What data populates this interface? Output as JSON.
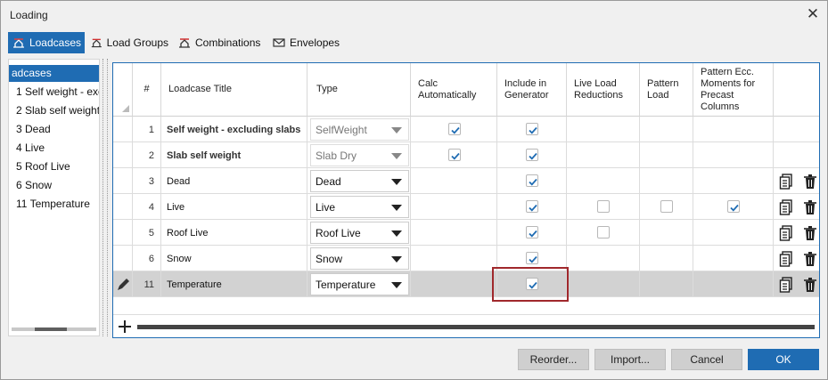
{
  "window": {
    "title": "Loading"
  },
  "tabs": [
    {
      "label": "Loadcases",
      "icon": "loadcase-icon"
    },
    {
      "label": "Load Groups",
      "icon": "load-group-icon"
    },
    {
      "label": "Combinations",
      "icon": "combination-icon"
    },
    {
      "label": "Envelopes",
      "icon": "envelope-icon"
    }
  ],
  "sidebar": {
    "items": [
      {
        "label": "adcases"
      },
      {
        "label": "1 Self weight - exc"
      },
      {
        "label": "2 Slab self weight"
      },
      {
        "label": "3 Dead"
      },
      {
        "label": "4 Live"
      },
      {
        "label": "5 Roof Live"
      },
      {
        "label": "6 Snow"
      },
      {
        "label": "11 Temperature"
      }
    ]
  },
  "grid": {
    "headers": {
      "num": "#",
      "title": "Loadcase Title",
      "type": "Type",
      "calc": "Calc Automatically",
      "include": "Include in Generator",
      "live": "Live Load Reductions",
      "pattern": "Pattern Load",
      "patecc": "Pattern Ecc. Moments for Precast Columns"
    },
    "rows": [
      {
        "num": "1",
        "title": "Self weight - excluding slabs",
        "bold": true,
        "type": "SelfWeight",
        "type_disabled": true,
        "calc": true,
        "include": true,
        "live": null,
        "pattern": null,
        "patecc": null,
        "actions": false
      },
      {
        "num": "2",
        "title": "Slab self weight",
        "bold": true,
        "type": "Slab Dry",
        "type_disabled": true,
        "calc": true,
        "include": true,
        "live": null,
        "pattern": null,
        "patecc": null,
        "actions": false
      },
      {
        "num": "3",
        "title": "Dead",
        "bold": false,
        "type": "Dead",
        "type_disabled": false,
        "calc": null,
        "include": true,
        "live": null,
        "pattern": null,
        "patecc": null,
        "actions": true
      },
      {
        "num": "4",
        "title": "Live",
        "bold": false,
        "type": "Live",
        "type_disabled": false,
        "calc": null,
        "include": true,
        "live": false,
        "pattern": false,
        "patecc": true,
        "actions": true
      },
      {
        "num": "5",
        "title": "Roof Live",
        "bold": false,
        "type": "Roof Live",
        "type_disabled": false,
        "calc": null,
        "include": true,
        "live": false,
        "pattern": null,
        "patecc": null,
        "actions": true
      },
      {
        "num": "6",
        "title": "Snow",
        "bold": false,
        "type": "Snow",
        "type_disabled": false,
        "calc": null,
        "include": true,
        "live": null,
        "pattern": null,
        "patecc": null,
        "actions": true
      },
      {
        "num": "11",
        "title": "Temperature",
        "bold": false,
        "type": "Temperature",
        "type_disabled": false,
        "calc": null,
        "include": true,
        "live": null,
        "pattern": null,
        "patecc": null,
        "actions": true,
        "selected": true
      }
    ]
  },
  "buttons": {
    "reorder": "Reorder...",
    "import": "Import...",
    "cancel": "Cancel",
    "ok": "OK"
  },
  "colors": {
    "accent": "#1f6cb3",
    "highlight": "#a0282c"
  }
}
